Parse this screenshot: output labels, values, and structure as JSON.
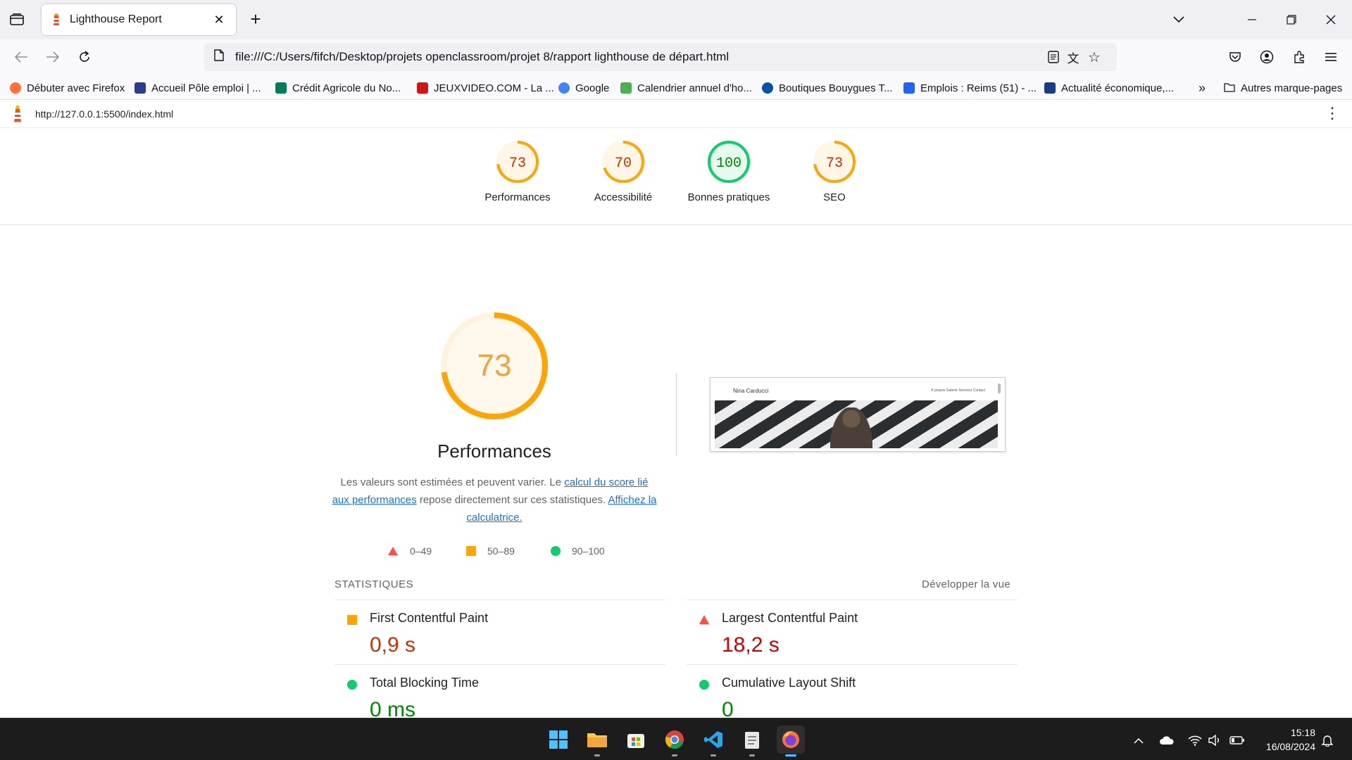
{
  "browser": {
    "tab_title": "Lighthouse Report",
    "url": "file:///C:/Users/fifch/Desktop/projets openclassroom/projet 8/rapport lighthouse de départ.html",
    "bookmarks": [
      {
        "label": "Débuter avec Firefox",
        "icon": "firefox-icon",
        "color": "#ff7139"
      },
      {
        "label": "Accueil Pôle emploi | ...",
        "icon": "pole-emploi-icon",
        "color": "#2a3d8f"
      },
      {
        "label": "Crédit Agricole du No...",
        "icon": "credit-agricole-icon",
        "color": "#007d5b"
      },
      {
        "label": "JEUXVIDEO.COM - La ...",
        "icon": "jeuxvideo-icon",
        "color": "#d11414"
      },
      {
        "label": "Google",
        "icon": "google-icon",
        "color": "#4285f4"
      },
      {
        "label": "Calendrier annuel d'ho...",
        "icon": "calendar-icon",
        "color": "#4caf50"
      },
      {
        "label": "Boutiques Bouygues T...",
        "icon": "bouygues-icon",
        "color": "#0055a4"
      },
      {
        "label": "Emplois : Reims (51) - ...",
        "icon": "indeed-icon",
        "color": "#2164f3"
      },
      {
        "label": "Actualité économique,...",
        "icon": "news-icon",
        "color": "#1a3a8a"
      }
    ],
    "other_bookmarks": "Autres marque-pages"
  },
  "report": {
    "tested_url": "http://127.0.0.1:5500/index.html",
    "categories": [
      {
        "label": "Performances",
        "score": "73",
        "value": 73,
        "rating": "average"
      },
      {
        "label": "Accessibilité",
        "score": "70",
        "value": 70,
        "rating": "average"
      },
      {
        "label": "Bonnes pratiques",
        "score": "100",
        "value": 100,
        "rating": "pass"
      },
      {
        "label": "SEO",
        "score": "73",
        "value": 73,
        "rating": "average"
      }
    ],
    "performance": {
      "score": "73",
      "value": 73,
      "title": "Performances",
      "desc_1": "Les valeurs sont estimées et peuvent varier. Le ",
      "link_1": "calcul du score lié aux performances",
      "desc_2": " repose directement sur ces statistiques. ",
      "link_2": "Affichez la calculatrice.",
      "screenshot_name": "Nina Carducci",
      "screenshot_nav": "À propos   Galerie   Services   Contact"
    },
    "legend": [
      {
        "label": "0–49",
        "shape": "triangle"
      },
      {
        "label": "50–89",
        "shape": "square"
      },
      {
        "label": "90–100",
        "shape": "circle"
      }
    ],
    "stats_title": "STATISTIQUES",
    "expand_label": "Développer la vue",
    "metrics": [
      {
        "title": "First Contentful Paint",
        "value": "0,9 s",
        "rating": "average"
      },
      {
        "title": "Largest Contentful Paint",
        "value": "18,2 s",
        "rating": "fail"
      },
      {
        "title": "Total Blocking Time",
        "value": "0 ms",
        "rating": "pass"
      },
      {
        "title": "Cumulative Layout Shift",
        "value": "0",
        "rating": "pass"
      }
    ]
  },
  "colors": {
    "pass": "#0cce6b",
    "pass_text": "#008800",
    "average": "#ffa400",
    "average_text": "#c33300",
    "fail": "#ff4e42",
    "fail_text": "#cc0000",
    "link": "#1a73e8"
  },
  "taskbar": {
    "time": "15:18",
    "date": "16/08/2024"
  }
}
